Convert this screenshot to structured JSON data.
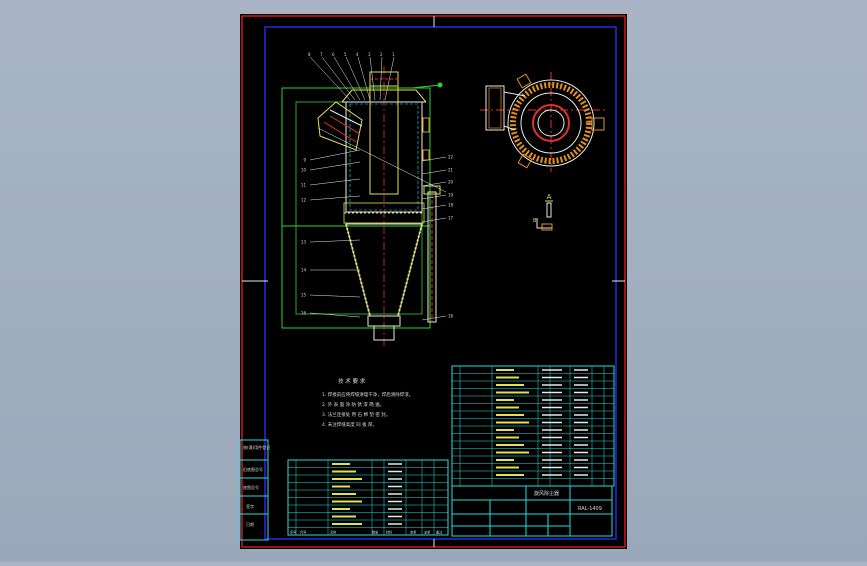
{
  "colors": {
    "viewport_bg": "#9aa8bb",
    "sheet_bg": "#000000",
    "outer_frame": "#d01818",
    "inner_frame": "#2828e0",
    "cyan": "#20e0e0",
    "yellow": "#e0e050",
    "green": "#30d030",
    "red": "#e03030",
    "orange": "#e09020",
    "white": "#e8e8e8"
  },
  "drawing": {
    "part_labels_top": [
      "8",
      "7",
      "6",
      "5",
      "4",
      "3",
      "2",
      "1"
    ],
    "part_labels_left": [
      "9",
      "10",
      "11",
      "12",
      "13",
      "14",
      "15",
      "16"
    ],
    "part_labels_right": [
      "22",
      "21",
      "20",
      "19",
      "18",
      "17",
      "16"
    ],
    "detail_a_label": "A",
    "detail_b_label": "B"
  },
  "tech_req": {
    "title": "技 术 要 求",
    "lines": [
      "1. 焊接前应将焊缝清理干净，焊后清除焊渣。",
      "2. 外 表 面 涂 防 锈 漆 两 遍。",
      "3. 法兰连接处 用 石 棉 垫 密 封。",
      "4. 未注焊缝高度 同 板 厚。"
    ]
  },
  "title_block": {
    "name_cell": "旋风除尘器",
    "drawing_no": "RAL-1409",
    "headers": [
      "序号",
      "代号",
      "名称",
      "数量",
      "材料",
      "单重",
      "总重",
      "备注"
    ]
  },
  "side_stamps": [
    "借(通)用件登记",
    "旧底图总号",
    "底图总号",
    "签字",
    "日期"
  ]
}
